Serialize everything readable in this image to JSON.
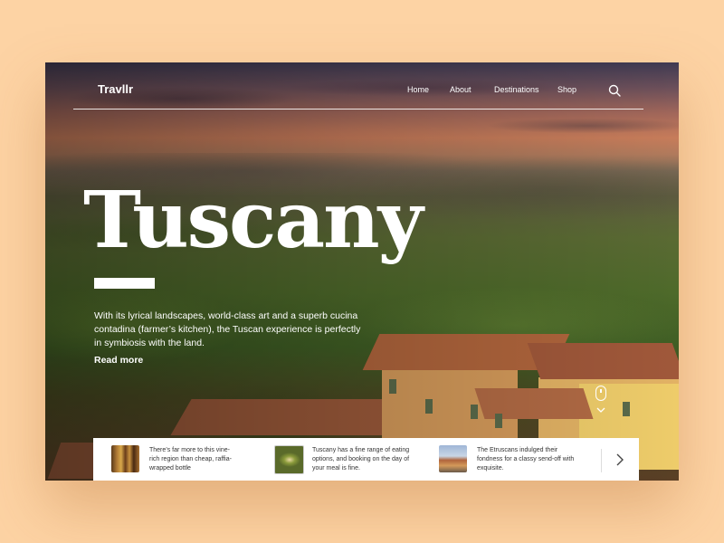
{
  "brand": "Travllr",
  "nav": {
    "items": [
      {
        "label": "Home"
      },
      {
        "label": "About"
      },
      {
        "label": "Destinations"
      },
      {
        "label": "Shop"
      }
    ],
    "search_icon": "search-icon"
  },
  "hero": {
    "title": "Tuscany",
    "description": "With its lyrical landscapes, world-class art and a superb cucina contadina (farmer’s kitchen), the Tuscan experience is perfectly in symbiosis with the land.",
    "read_more": "Read more"
  },
  "cards": [
    {
      "text": "There’s far more to this vine-rich region than cheap, raffia-wrapped bottle",
      "thumb": "wine-bottles"
    },
    {
      "text": "Tuscany has a fine range of eating options, and booking on the day of your meal is fine.",
      "thumb": "food-plate"
    },
    {
      "text": "The Etruscans indulged their fondness for a classy send-off with exquisite.",
      "thumb": "florence-cathedral"
    }
  ],
  "controls": {
    "next_icon": "chevron-right-icon",
    "scroll_icon": "mouse-scroll-icon"
  },
  "colors": {
    "background": "#fdd3a4",
    "text_on_image": "#ffffff",
    "panel": "#ffffff"
  }
}
